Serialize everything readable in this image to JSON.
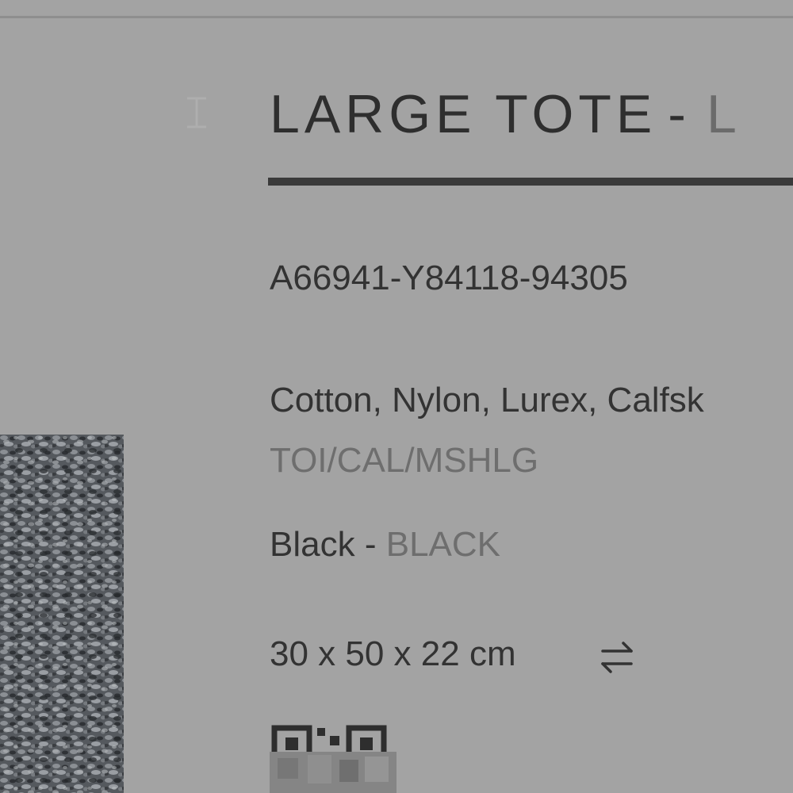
{
  "product": {
    "title": "LARGE TOTE",
    "title_separator": "-",
    "title_secondary": "L",
    "sku": "A66941-Y84118-94305",
    "materials": "Cotton, Nylon, Lurex, Calfsk",
    "materials_code": "TOI/CAL/MSHLG",
    "color_name": "Black",
    "color_separator": "-",
    "color_code": "BLACK",
    "dimensions": "30 x 50 x 22 cm"
  },
  "icons": {
    "swap": "swap-arrows-icon",
    "qr": "qr-code-icon",
    "swatch": "fabric-swatch-image"
  },
  "colors": {
    "background": "#a3a3a3",
    "text": "#333333",
    "muted_text": "#6e6e6e",
    "title_rule": "#3a3a3a"
  }
}
